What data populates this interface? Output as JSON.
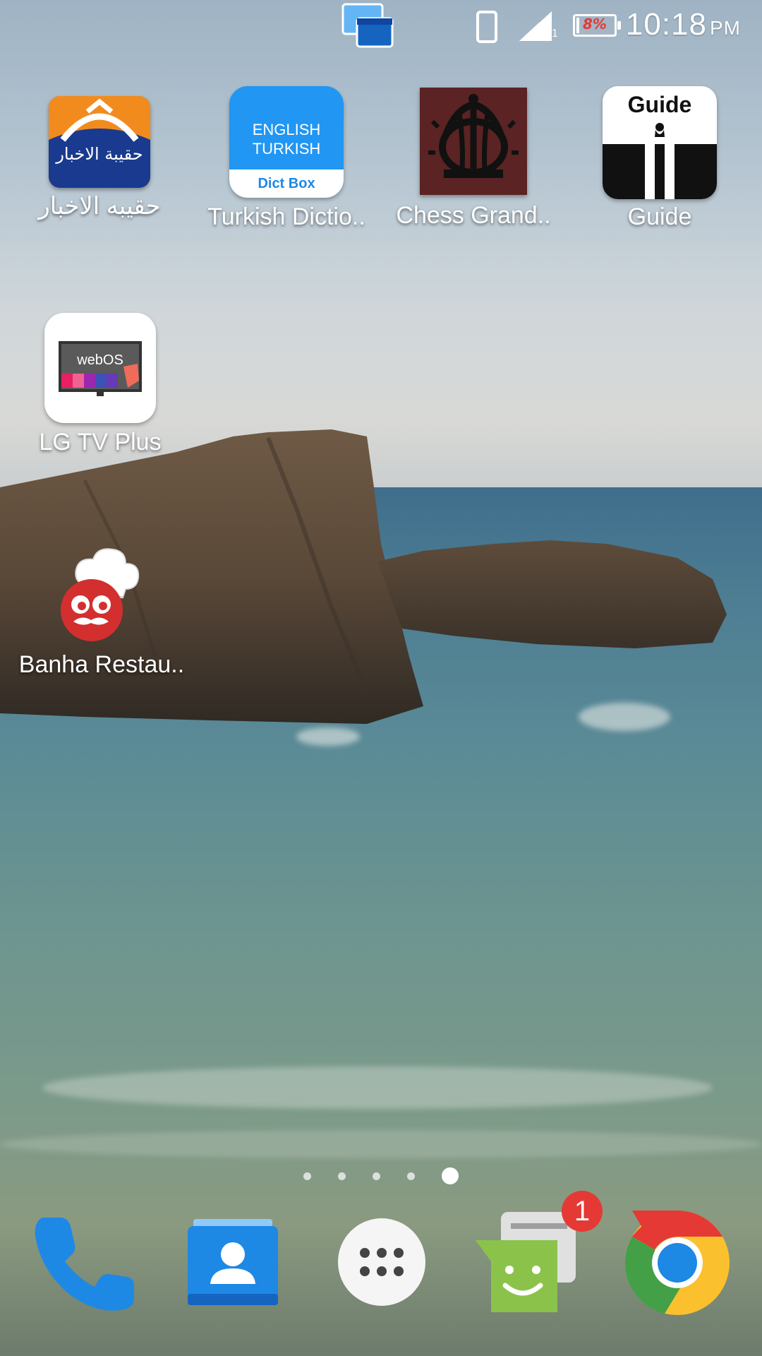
{
  "statusbar": {
    "time": "10:18",
    "ampm": "PM",
    "battery_percent": "8%",
    "battery_level": 0.08,
    "signal_sim": "1"
  },
  "apps": [
    {
      "label": "حقيبه الاخبار",
      "icon_text": "حقيبة الاخبار",
      "icon": "news-bag-icon"
    },
    {
      "label": "Turkish Dictio..",
      "icon_text_1": "ENGLISH",
      "icon_text_2": "TURKISH",
      "icon_text_3": "Dict Box",
      "icon": "dictionary-icon"
    },
    {
      "label": "Chess Grand..",
      "icon": "crown-icon"
    },
    {
      "label": "Guide",
      "icon_text": "Guide",
      "icon": "guide-icon"
    },
    {
      "label": "LG TV Plus",
      "icon_text": "webOS",
      "icon": "tv-icon"
    },
    {
      "label": "Banha Restau..",
      "icon": "chef-icon"
    }
  ],
  "notification_badge": "1",
  "page_indicator": {
    "count": 5,
    "active": 5
  },
  "colors": {
    "phone": "#1e88e5",
    "contacts": "#1976d2",
    "messages": "#8bc34a",
    "badge": "#e53935",
    "dict_blue": "#2196f3"
  }
}
